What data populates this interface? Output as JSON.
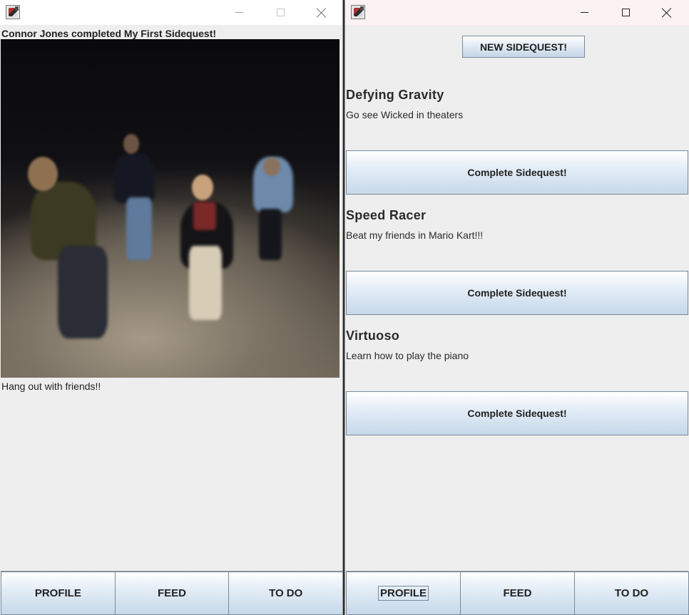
{
  "left_window": {
    "feed_post": {
      "header": "Connor Jones completed My First Sidequest!",
      "caption": "Hang out with friends!!"
    },
    "nav": {
      "profile": "PROFILE",
      "feed": "FEED",
      "todo": "TO DO"
    }
  },
  "right_window": {
    "new_sidequest_label": "NEW SIDEQUEST!",
    "quests": [
      {
        "title": "Defying Gravity",
        "description": "Go see Wicked in theaters",
        "button": "Complete Sidequest!"
      },
      {
        "title": "Speed Racer",
        "description": "Beat my friends in Mario Kart!!!",
        "button": "Complete Sidequest!"
      },
      {
        "title": "Virtuoso",
        "description": "Learn how to play the piano",
        "button": "Complete Sidequest!"
      }
    ],
    "nav": {
      "profile": "PROFILE",
      "feed": "FEED",
      "todo": "TO DO"
    }
  }
}
